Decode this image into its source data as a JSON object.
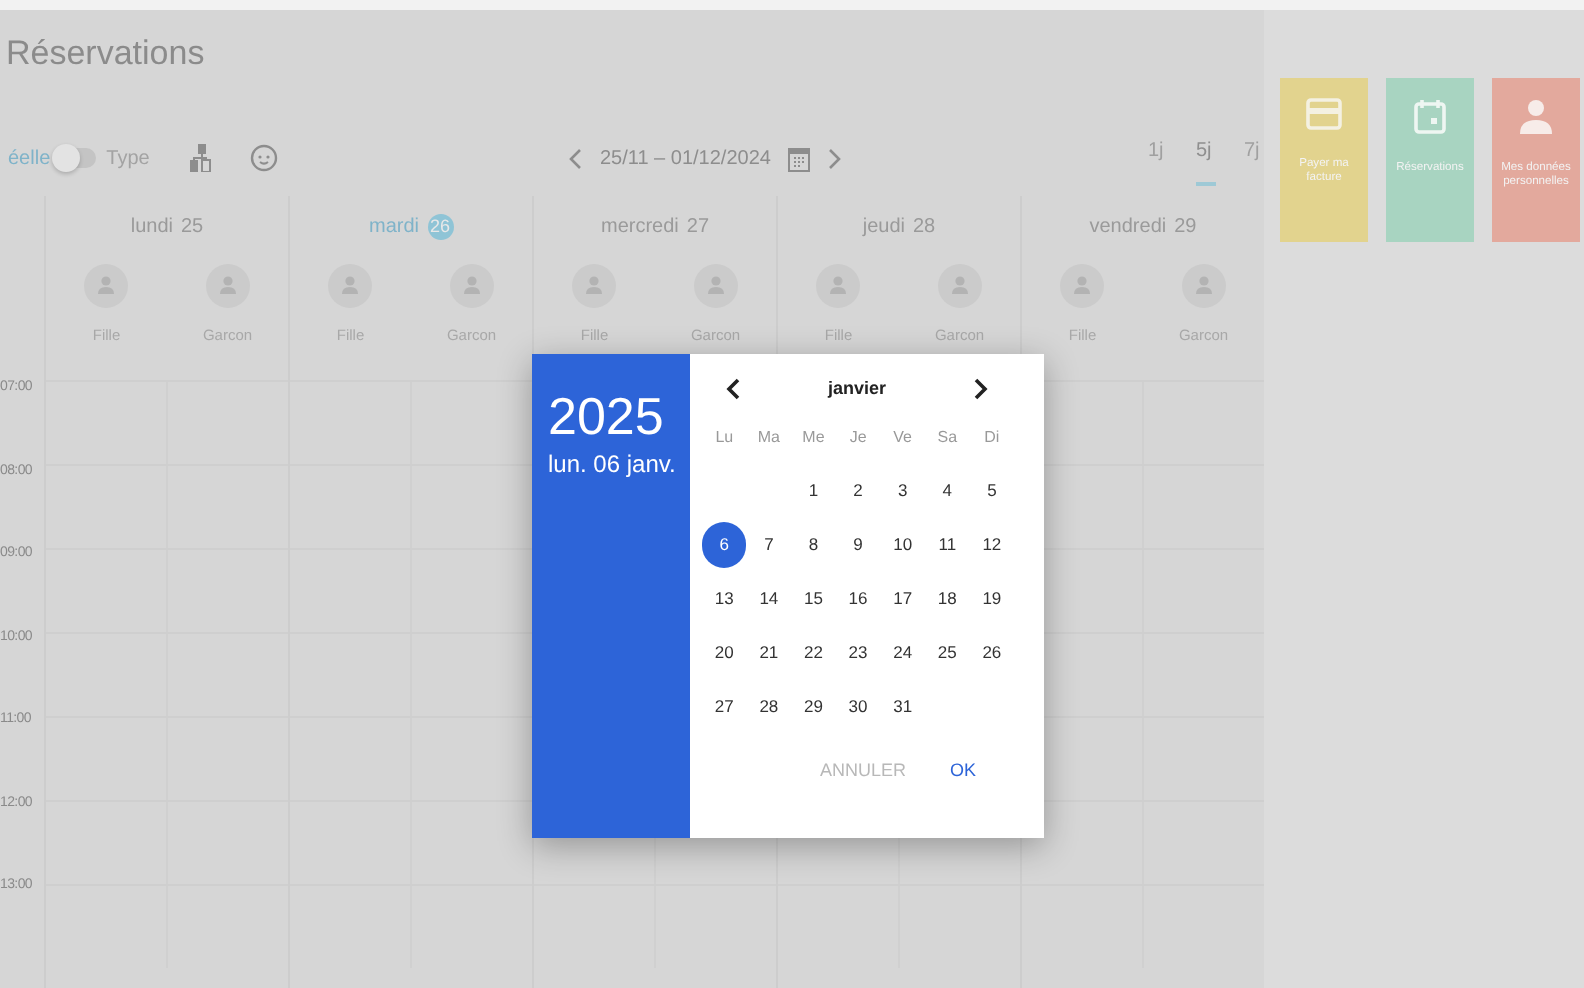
{
  "title": "Réservations",
  "modes": [
    {
      "label": "éelle",
      "selected": true
    },
    {
      "label": "Type",
      "selected": false
    }
  ],
  "toggle": {
    "on": false
  },
  "date_range": "25/11 – 01/12/2024",
  "view_options": [
    {
      "label": "1j",
      "selected": false
    },
    {
      "label": "5j",
      "selected": true
    },
    {
      "label": "7j",
      "selected": false
    }
  ],
  "days": [
    {
      "name": "lundi",
      "number": "25",
      "today": false,
      "slots": [
        "Fille",
        "Garcon"
      ]
    },
    {
      "name": "mardi",
      "number": "26",
      "today": true,
      "slots": [
        "Fille",
        "Garcon"
      ]
    },
    {
      "name": "mercredi",
      "number": "27",
      "today": false,
      "slots": [
        "Fille",
        "Garcon"
      ]
    },
    {
      "name": "jeudi",
      "number": "28",
      "today": false,
      "slots": [
        "Fille",
        "Garcon"
      ]
    },
    {
      "name": "vendredi",
      "number": "29",
      "today": false,
      "slots": [
        "Fille",
        "Garcon"
      ]
    }
  ],
  "hours": [
    "07:00",
    "08:00",
    "09:00",
    "10:00",
    "11:00",
    "12:00",
    "13:00"
  ],
  "tiles": [
    {
      "kind": "card",
      "label": "Payer ma facture",
      "color": "#e2d38e"
    },
    {
      "kind": "calendar",
      "label": "Réservations",
      "color": "#a8d4c1"
    },
    {
      "kind": "person",
      "label": "Mes données personnelles",
      "color": "#e3a99d"
    }
  ],
  "date_picker": {
    "year": "2025",
    "date": "lun. 06 janv.",
    "month": "janvier",
    "weekdays": [
      "Lu",
      "Ma",
      "Me",
      "Je",
      "Ve",
      "Sa",
      "Di"
    ],
    "weeks": [
      {
        "days": [
          {
            "kind": "blank"
          },
          {
            "kind": "blank"
          },
          {
            "label": "1",
            "selected": false
          },
          {
            "label": "2",
            "selected": false
          },
          {
            "label": "3",
            "selected": false
          },
          {
            "label": "4",
            "selected": false
          },
          {
            "label": "5",
            "selected": false
          }
        ]
      },
      {
        "days": [
          {
            "label": "6",
            "selected": true
          },
          {
            "label": "7",
            "selected": false
          },
          {
            "label": "8",
            "selected": false
          },
          {
            "label": "9",
            "selected": false
          },
          {
            "label": "10",
            "selected": false
          },
          {
            "label": "11",
            "selected": false
          },
          {
            "label": "12",
            "selected": false
          }
        ]
      },
      {
        "days": [
          {
            "label": "13",
            "selected": false
          },
          {
            "label": "14",
            "selected": false
          },
          {
            "label": "15",
            "selected": false
          },
          {
            "label": "16",
            "selected": false
          },
          {
            "label": "17",
            "selected": false
          },
          {
            "label": "18",
            "selected": false
          },
          {
            "label": "19",
            "selected": false
          }
        ]
      },
      {
        "days": [
          {
            "label": "20",
            "selected": false
          },
          {
            "label": "21",
            "selected": false
          },
          {
            "label": "22",
            "selected": false
          },
          {
            "label": "23",
            "selected": false
          },
          {
            "label": "24",
            "selected": false
          },
          {
            "label": "25",
            "selected": false
          },
          {
            "label": "26",
            "selected": false
          }
        ]
      },
      {
        "days": [
          {
            "label": "27",
            "selected": false
          },
          {
            "label": "28",
            "selected": false
          },
          {
            "label": "29",
            "selected": false
          },
          {
            "label": "30",
            "selected": false
          },
          {
            "label": "31",
            "selected": false
          }
        ]
      }
    ],
    "buttons": [
      {
        "label": "ANNULER",
        "disabled": true
      },
      {
        "label": "OK",
        "disabled": false
      }
    ]
  }
}
